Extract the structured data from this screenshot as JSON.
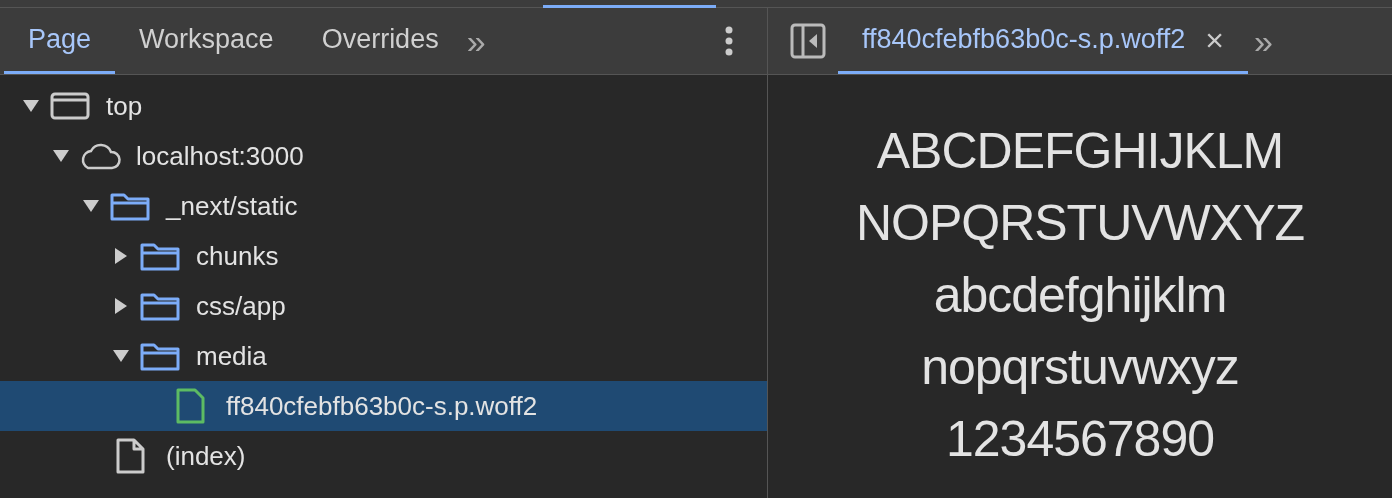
{
  "navigator_tabs": [
    {
      "label": "Page",
      "selected": true
    },
    {
      "label": "Workspace",
      "selected": false
    },
    {
      "label": "Overrides",
      "selected": false
    }
  ],
  "more_tabs": "»",
  "tree": [
    {
      "label": "top",
      "kind": "frame",
      "expanded": true,
      "selected": false,
      "children": [
        {
          "label": "localhost:3000",
          "kind": "cloud",
          "expanded": true,
          "selected": false,
          "children": [
            {
              "label": "_next/static",
              "kind": "folder",
              "expanded": true,
              "selected": false,
              "children": [
                {
                  "label": "chunks",
                  "kind": "folder",
                  "expanded": false,
                  "selected": false
                },
                {
                  "label": "css/app",
                  "kind": "folder",
                  "expanded": false,
                  "selected": false
                },
                {
                  "label": "media",
                  "kind": "folder",
                  "expanded": true,
                  "selected": false,
                  "children": [
                    {
                      "label": "ff840cfebfb63b0c-s.p.woff2",
                      "kind": "font",
                      "selected": true
                    }
                  ]
                }
              ]
            },
            {
              "label": "(index)",
              "kind": "document",
              "selected": false
            }
          ]
        }
      ]
    }
  ],
  "editor_tabs": [
    {
      "label": "ff840cfebfb63b0c-s.p.woff2",
      "selected": true,
      "close": "×"
    }
  ],
  "editor_more": "»",
  "font_preview": [
    "ABCDEFGHIJKLM",
    "NOPQRSTUVWXYZ",
    "abcdefghijklm",
    "nopqrstuvwxyz",
    "1234567890"
  ]
}
